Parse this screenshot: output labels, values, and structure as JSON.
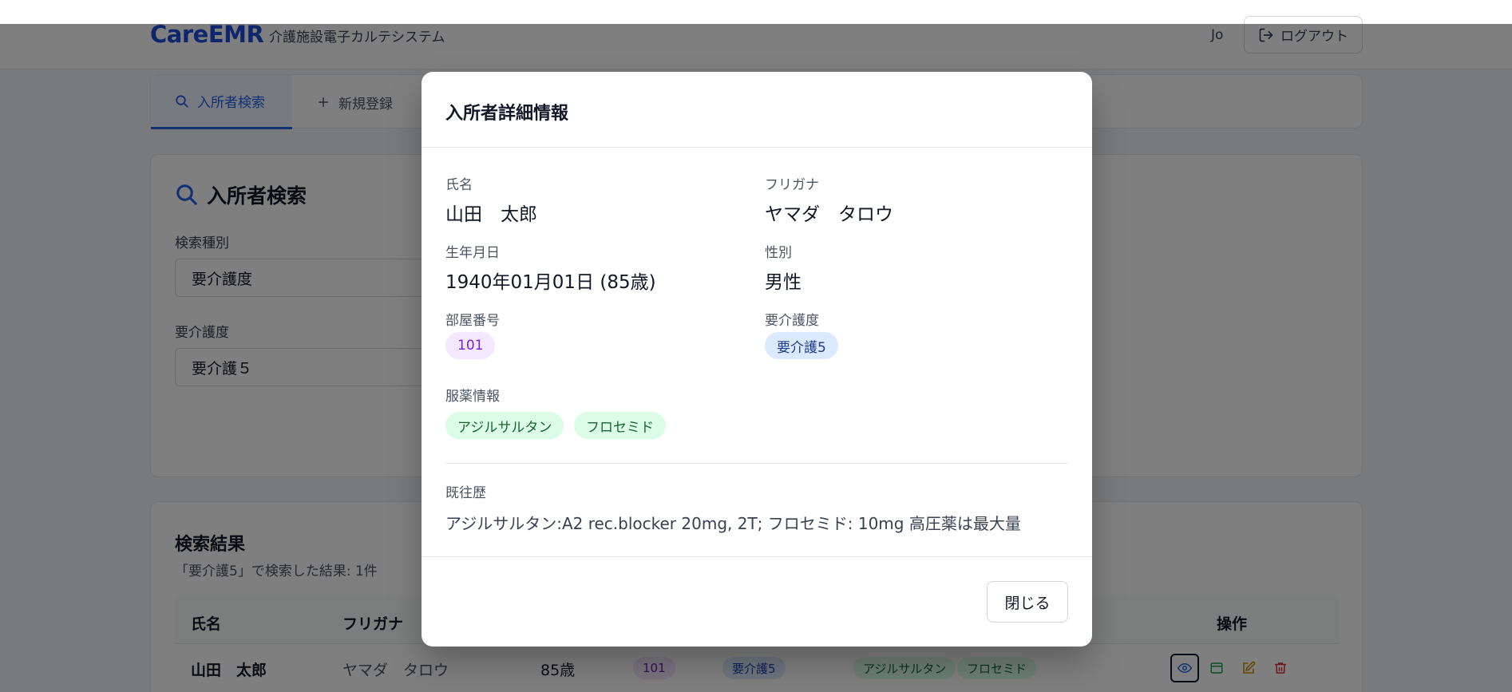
{
  "header": {
    "logo": "CareEMR",
    "subtitle": "介護施設電子カルテシステム",
    "user": "Jo",
    "logout_label": "ログアウト"
  },
  "tabs": [
    {
      "label": "入所者検索",
      "icon": "search-icon",
      "active": true
    },
    {
      "label": "新規登録",
      "icon": "plus-icon",
      "active": false
    }
  ],
  "search": {
    "title": "入所者検索",
    "type_label": "検索種別",
    "type_value": "要介護度",
    "level_label": "要介護度",
    "level_value": "要介護５"
  },
  "results": {
    "title": "検索結果",
    "count_text": "「要介護5」で検索した結果: 1件",
    "columns": [
      "氏名",
      "フリガナ",
      "操作"
    ],
    "rows": [
      {
        "name": "山田　太郎",
        "furigana": "ヤマダ　タロウ",
        "age": "85歳",
        "room": "101",
        "care_level": "要介護5",
        "meds": [
          "アジルサルタン",
          "フロセミド"
        ]
      }
    ],
    "actions": [
      "view-icon",
      "chart-icon",
      "edit-icon",
      "delete-icon"
    ]
  },
  "modal": {
    "title": "入所者詳細情報",
    "name_label": "氏名",
    "name_value": "山田　太郎",
    "furigana_label": "フリガナ",
    "furigana_value": "ヤマダ　タロウ",
    "dob_label": "生年月日",
    "dob_value": "1940年01月01日 (85歳)",
    "gender_label": "性別",
    "gender_value": "男性",
    "room_label": "部屋番号",
    "room_value": "101",
    "care_label": "要介護度",
    "care_value": "要介護5",
    "meds_label": "服薬情報",
    "meds": [
      "アジルサルタン",
      "フロセミド"
    ],
    "history_label": "既往歴",
    "history_value": "アジルサルタン:A2 rec.blocker 20mg, 2T; フロセミド: 10mg 高圧薬は最大量",
    "close_label": "閉じる"
  },
  "colors": {
    "brand": "#1d4ed8",
    "overlay": "rgba(0,0,0,0.5)"
  }
}
